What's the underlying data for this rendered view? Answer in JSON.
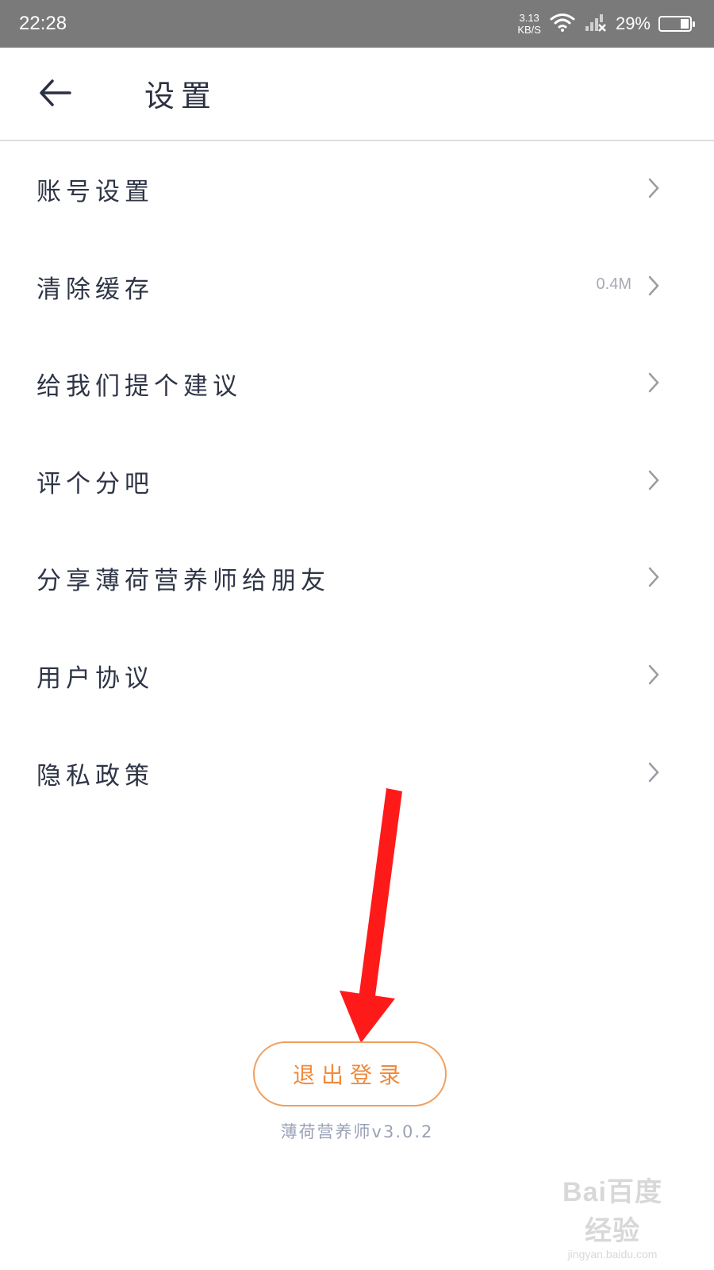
{
  "status_bar": {
    "time": "22:28",
    "net_speed_value": "3.13",
    "net_speed_unit": "KB/S",
    "battery_percent": "29%",
    "battery_level": 0.29
  },
  "header": {
    "title": "设置"
  },
  "settings": {
    "items": [
      {
        "label": "账号设置",
        "value": ""
      },
      {
        "label": "清除缓存",
        "value": "0.4M"
      },
      {
        "label": "给我们提个建议",
        "value": ""
      },
      {
        "label": "评个分吧",
        "value": ""
      },
      {
        "label": "分享薄荷营养师给朋友",
        "value": ""
      },
      {
        "label": "用户协议",
        "value": ""
      },
      {
        "label": "隐私政策",
        "value": ""
      }
    ]
  },
  "logout": {
    "label": "退出登录"
  },
  "version": {
    "text": "薄荷营养师v3.0.2"
  },
  "watermark": {
    "logo": "Bai百度经验",
    "url": "jingyan.baidu.com"
  },
  "colors": {
    "accent": "#ef8a3e",
    "annotation_arrow": "#ff1a1a"
  }
}
